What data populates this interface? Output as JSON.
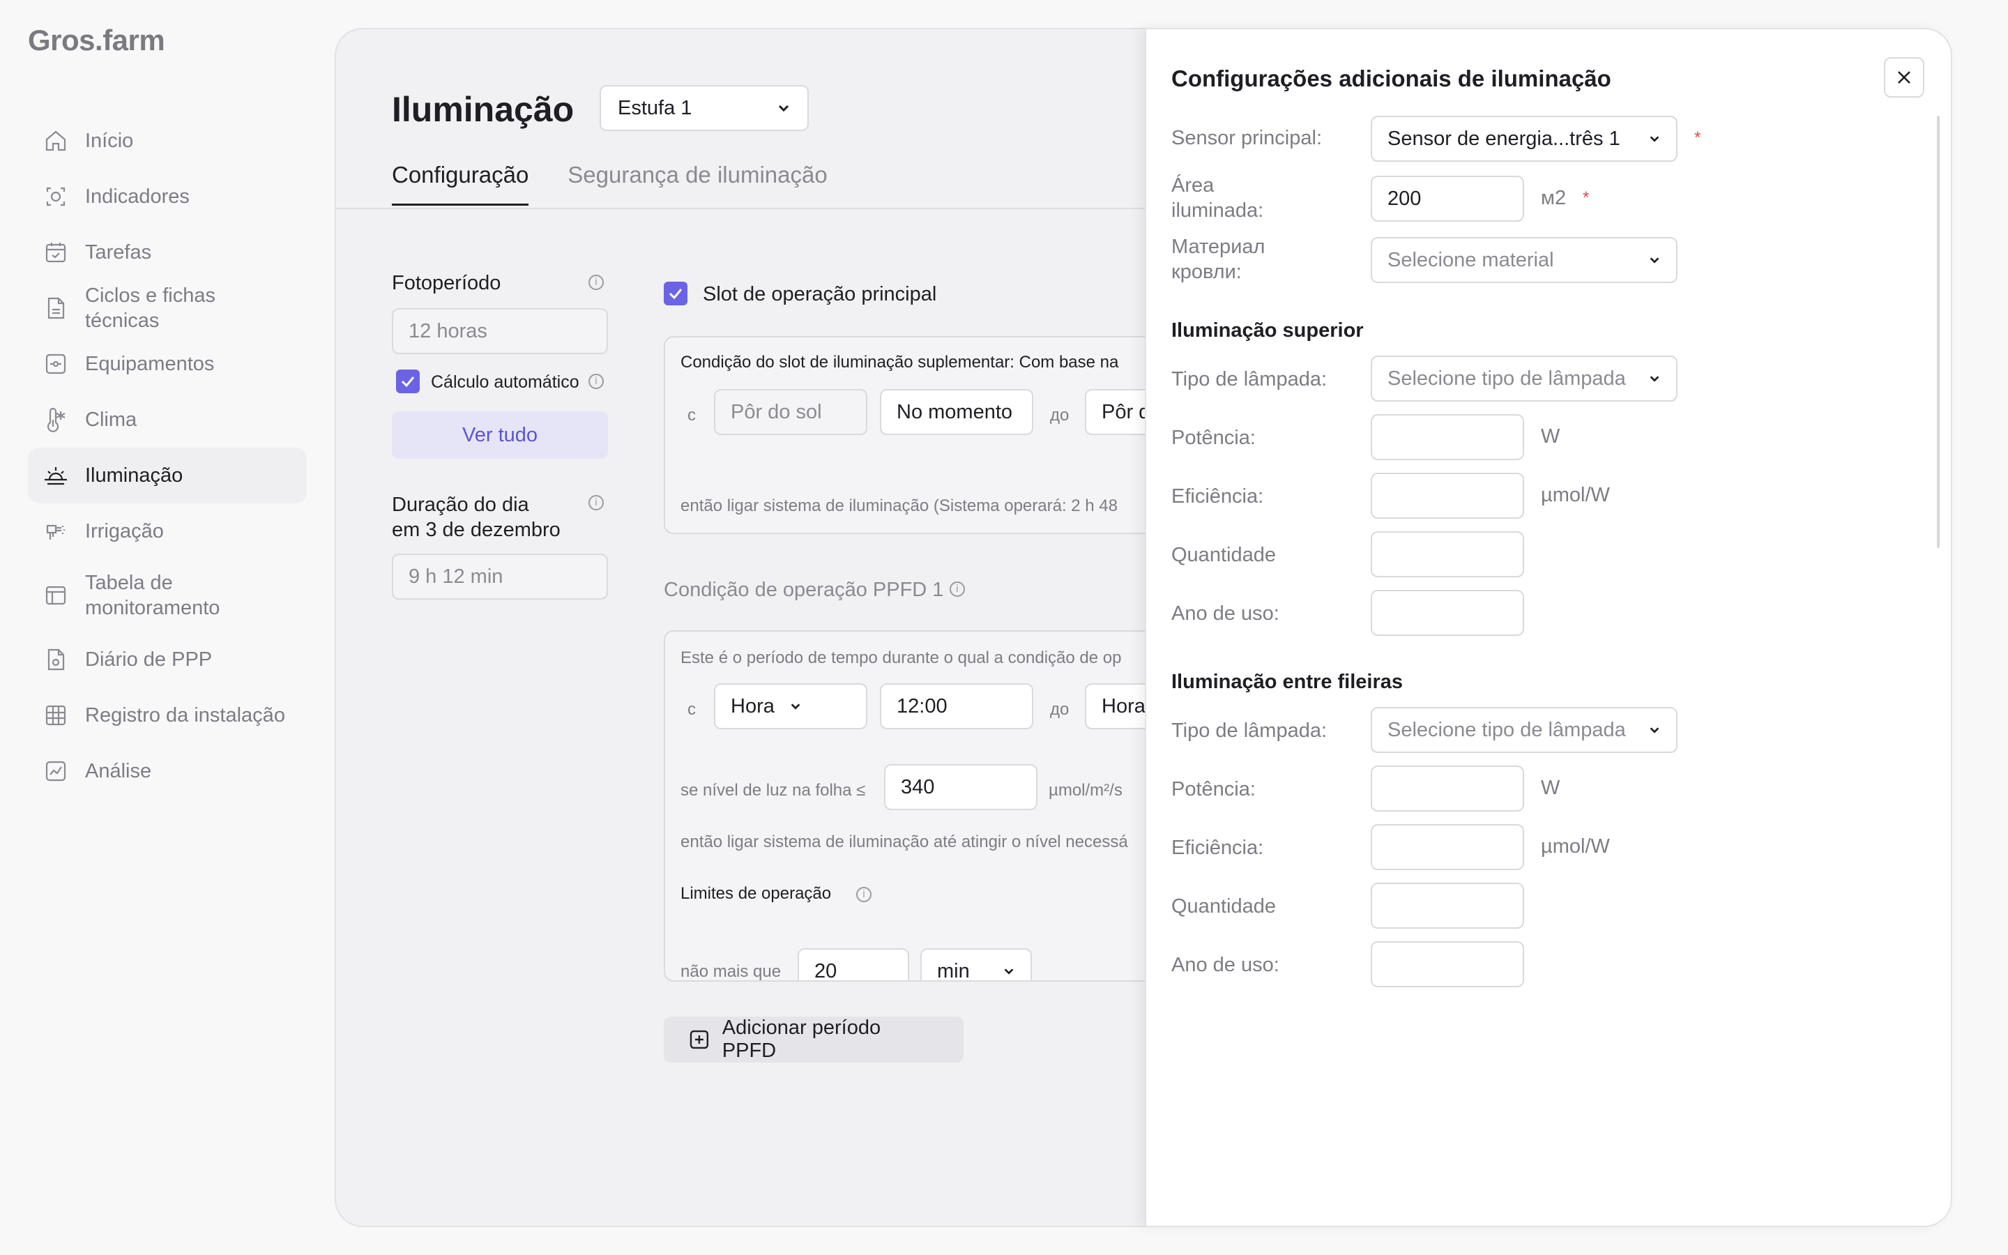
{
  "app": {
    "logo": "Gros.farm"
  },
  "sidebar": {
    "items": [
      {
        "label": "Início",
        "icon": "home-icon"
      },
      {
        "label": "Indicadores",
        "icon": "indicators-icon"
      },
      {
        "label": "Tarefas",
        "icon": "calendar-icon"
      },
      {
        "label": "Ciclos e fichas técnicas",
        "icon": "document-icon"
      },
      {
        "label": "Equipamentos",
        "icon": "equipment-icon"
      },
      {
        "label": "Clima",
        "icon": "climate-icon"
      },
      {
        "label": "Iluminação",
        "icon": "sunrise-icon",
        "active": true
      },
      {
        "label": "Irrigação",
        "icon": "irrigation-icon"
      },
      {
        "label": "Tabela de monitoramento",
        "icon": "table-icon"
      },
      {
        "label": "Diário de PPP",
        "icon": "ppp-diary-icon"
      },
      {
        "label": "Registro da instalação",
        "icon": "grid-icon"
      },
      {
        "label": "Análise",
        "icon": "chart-icon"
      }
    ]
  },
  "main": {
    "title": "Iluminação",
    "greenhouse_select": "Estufa 1",
    "tabs": [
      "Configuração",
      "Segurança de iluminação"
    ],
    "photoperiod": {
      "label": "Fotoperíodo",
      "value": "12 horas",
      "auto_label": "Cálculo automático",
      "see_all": "Ver tudo"
    },
    "day_length": {
      "label_line1": "Duração do dia",
      "label_line2": "em 3 de dezembro",
      "value": "9 h 12 min"
    },
    "slot": {
      "checkbox_label": "Slot de operação principal",
      "condition_text": "Condição do slot de iluminação suplementar: Com base na",
      "from": "с",
      "from_value": "Pôr do sol",
      "moment": "No momento",
      "to": "до",
      "to_value": "Pôr d",
      "then_text": "então ligar sistema de iluminação (Sistema operará: 2 h 48"
    },
    "ppfd": {
      "title": "Condição de operação PPFD 1",
      "period_text": "Este é o período de tempo durante o qual a condição de op",
      "from": "с",
      "from_type": "Hora",
      "from_time": "12:00",
      "to": "до",
      "to_type": "Hora",
      "light_text": "se nível de luz na folha ≤",
      "light_value": "340",
      "light_unit": "µmol/m²/s",
      "then_text": "então ligar sistema de iluminação até atingir o nível necessá",
      "limits_label": "Limites de operação",
      "no_more_than": "não mais que",
      "limit_value": "20",
      "limit_unit": "min"
    },
    "add_button": "Adicionar período PPFD"
  },
  "drawer": {
    "title": "Configurações adicionais de iluminação",
    "sensor_label": "Sensor principal:",
    "sensor_value": "Sensor de energia...três 1",
    "area_label_1": "Área",
    "area_label_2": "iluminada:",
    "area_value": "200",
    "area_unit": "м2",
    "material_label_1": "Материал",
    "material_label_2": "кровли:",
    "material_placeholder": "Selecione material",
    "required_mark": "*",
    "top": {
      "title": "Iluminação superior",
      "lamp_label": "Tipo de lâmpada:",
      "lamp_placeholder": "Selecione tipo de lâmpada",
      "power_label": "Potência:",
      "power_unit": "W",
      "efficiency_label": "Eficiência:",
      "efficiency_unit": "µmol/W",
      "quantity_label": "Quantidade",
      "year_label": "Ano de uso:"
    },
    "rows": {
      "title": "Iluminação entre fileiras",
      "lamp_label": "Tipo de lâmpada:",
      "lamp_placeholder": "Selecione tipo de lâmpada",
      "power_label": "Potência:",
      "power_unit": "W",
      "efficiency_label": "Eficiência:",
      "efficiency_unit": "µmol/W",
      "quantity_label": "Quantidade",
      "year_label": "Ano de uso:"
    }
  }
}
